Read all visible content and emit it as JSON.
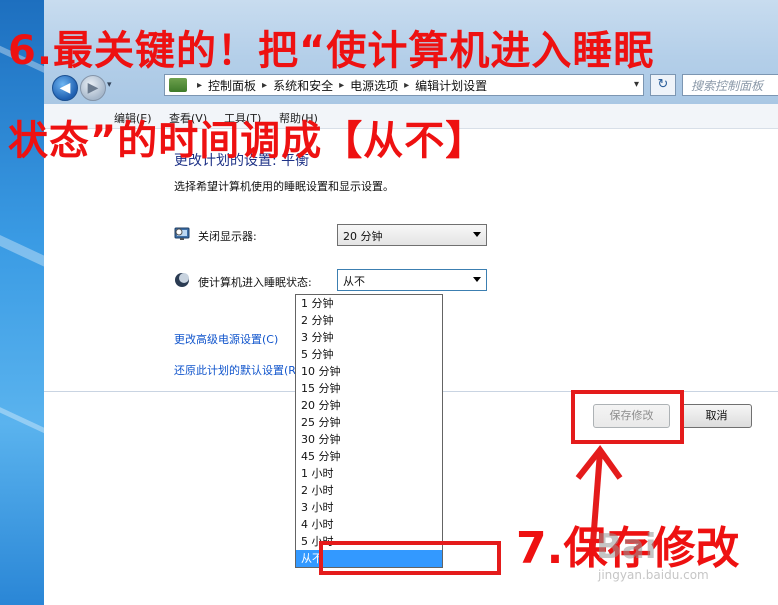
{
  "annotations": {
    "step6_line1": "6.最关键的！把“使计算机进入睡眠",
    "step6_line2": "状态”的时间调成【从不】",
    "step7": "7.保存修改",
    "watermark": "Bai",
    "watermark_sub": "jingyan.baidu.com"
  },
  "toolbar": {
    "back_symbol": "◀",
    "forward_symbol": "▶",
    "history_symbol": "▾",
    "refresh_symbol": "↻",
    "search_placeholder": "搜索控制面板"
  },
  "breadcrumb": {
    "items": [
      "控制面板",
      "系统和安全",
      "电源选项",
      "编辑计划设置"
    ],
    "separator": "▸",
    "dropdown_symbol": "▾"
  },
  "menubar": {
    "items": [
      "编辑(E)",
      "查看(V)",
      "工具(T)",
      "帮助(H)"
    ]
  },
  "main": {
    "title": "更改计划的设置: 平衡",
    "description": "选择希望计算机使用的睡眠设置和显示设置。",
    "display_off": {
      "label": "关闭显示器:",
      "value": "20 分钟",
      "icon": "monitor-icon"
    },
    "sleep": {
      "label": "使计算机进入睡眠状态:",
      "value": "从不",
      "icon": "moon-icon"
    },
    "link_advanced": "更改高级电源设置(C)",
    "link_restore": "还原此计划的默认设置(R)",
    "save_button": "保存修改",
    "cancel_button": "取消"
  },
  "sleep_options": [
    "1 分钟",
    "2 分钟",
    "3 分钟",
    "5 分钟",
    "10 分钟",
    "15 分钟",
    "20 分钟",
    "25 分钟",
    "30 分钟",
    "45 分钟",
    "1 小时",
    "2 小时",
    "3 小时",
    "4 小时",
    "5 小时",
    "从不"
  ],
  "sleep_selected_index": 15,
  "colors": {
    "annotation_red": "#e41b1b",
    "heading_blue": "#1e3287",
    "link_blue": "#1155cc",
    "selection_blue": "#3399ff"
  }
}
